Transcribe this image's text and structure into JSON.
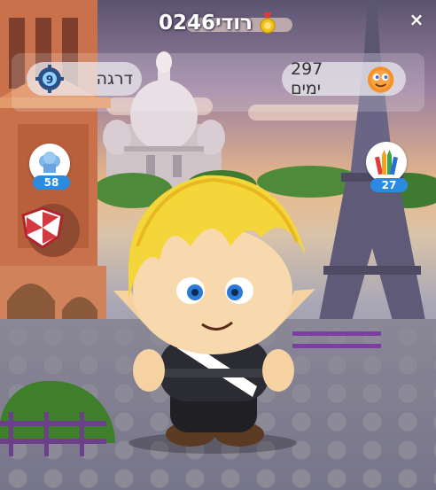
{
  "profile": {
    "username": "רודי0246",
    "close_symbol": "×",
    "level_label": "דרגה",
    "level_value": "9",
    "days_label": "297 ימים"
  },
  "badges": {
    "chef_count": "58",
    "crayons_count": "27"
  },
  "icons": {
    "medal": "medal-icon",
    "gear": "gear-level-icon",
    "sun": "sun-days-icon",
    "chef": "chef-hat-icon",
    "crayons": "crayons-icon",
    "shield": "shield-icon"
  }
}
